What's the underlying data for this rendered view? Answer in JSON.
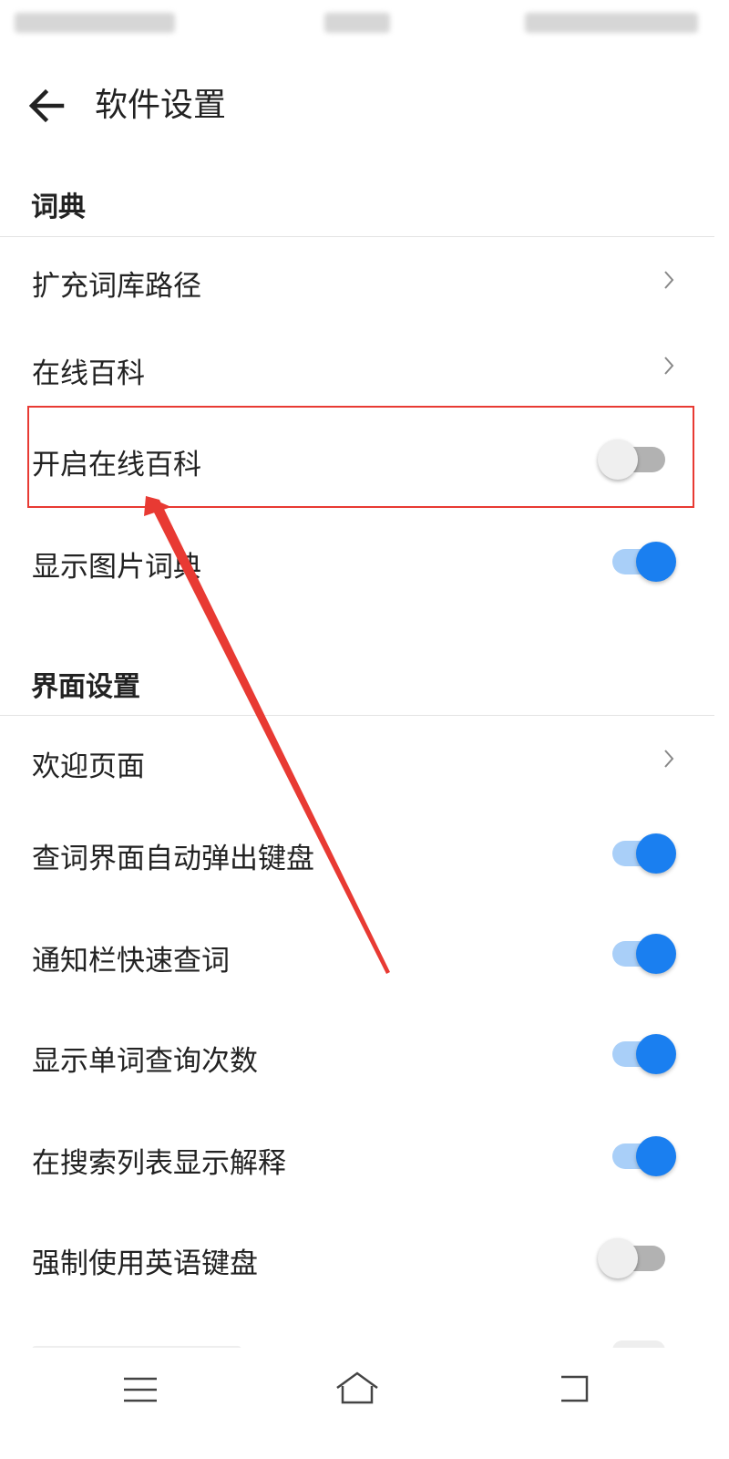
{
  "app": {
    "title": "软件设置"
  },
  "sections": {
    "dictionary": {
      "header": "词典",
      "items": {
        "expand_path": {
          "label": "扩充词库路径"
        },
        "online_wiki": {
          "label": "在线百科"
        },
        "enable_online_wiki": {
          "label": "开启在线百科",
          "enabled": false
        },
        "show_image_dict": {
          "label": "显示图片词典",
          "enabled": true
        }
      }
    },
    "interface": {
      "header": "界面设置",
      "items": {
        "welcome_page": {
          "label": "欢迎页面"
        },
        "auto_keyboard": {
          "label": "查词界面自动弹出键盘",
          "enabled": true
        },
        "notify_quick": {
          "label": "通知栏快速查词",
          "enabled": true
        },
        "show_count": {
          "label": "显示单词查询次数",
          "enabled": true
        },
        "show_explain": {
          "label": "在搜索列表显示解释",
          "enabled": true
        },
        "force_english_kb": {
          "label": "强制使用英语键盘",
          "enabled": false
        }
      }
    }
  },
  "icons": {
    "back": "arrow-left-icon",
    "chevron": "chevron-right-icon",
    "nav_menu": "menu-icon",
    "nav_home": "home-icon",
    "nav_back": "back-icon"
  },
  "colors": {
    "accent": "#1a7ff0",
    "annotation": "#e83a33"
  }
}
